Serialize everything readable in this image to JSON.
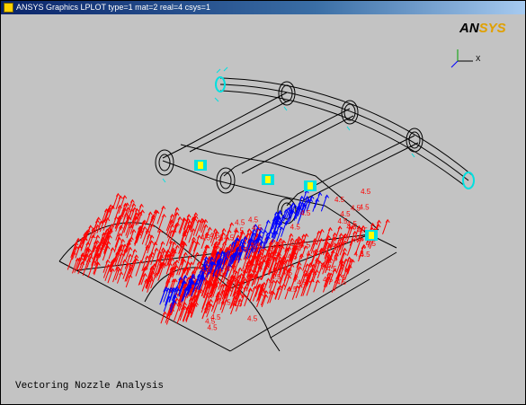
{
  "window": {
    "title": "ANSYS Graphics   LPLOT  type=1 mat=2 real=4 csys=1"
  },
  "logo": {
    "part1": "AN",
    "part2": "SYS"
  },
  "triad": {
    "axis_label": "X"
  },
  "caption": "Vectoring Nozzle Analysis",
  "vector_label": "4.5",
  "colors": {
    "background": "#c3c3c3",
    "geometry": "#000000",
    "pressure_vectors": "#ff0000",
    "blue_vectors": "#0000ff",
    "constraints": "#00e0e0",
    "highlight": "#ffff00"
  }
}
